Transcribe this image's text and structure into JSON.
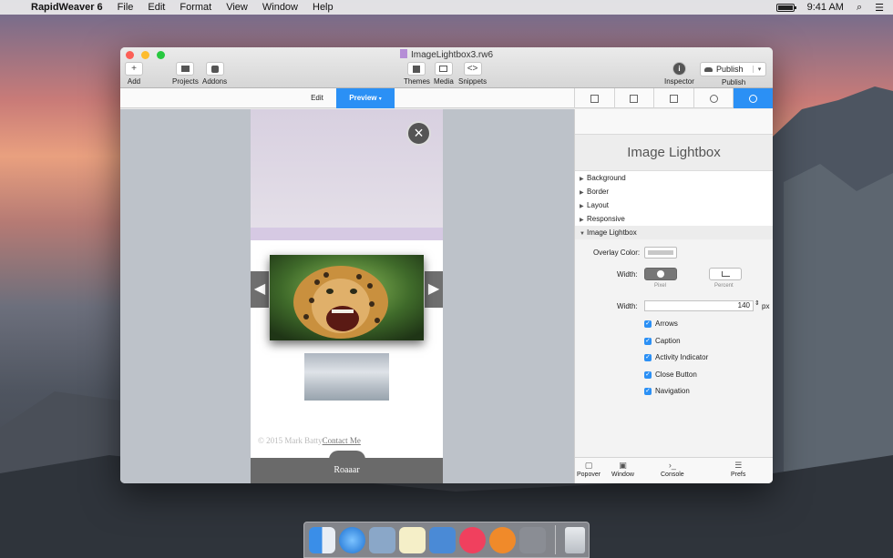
{
  "menubar": {
    "apple": "",
    "items": [
      "RapidWeaver 6",
      "File",
      "Edit",
      "Format",
      "View",
      "Window",
      "Help"
    ],
    "clock": "9:41 AM",
    "search_icon": "⌕",
    "list_icon": "☰"
  },
  "window": {
    "title": "ImageLightbox3.rw6",
    "toolbar": {
      "add": "Add",
      "add_glyph": "+",
      "projects": "Projects",
      "addons": "Addons",
      "themes": "Themes",
      "media": "Media",
      "snippets": "Snippets",
      "snippets_glyph": "<>",
      "inspector": "Inspector",
      "inspector_glyph": "i",
      "publish_button": "Publish",
      "publish_label": "Publish"
    },
    "tabs": {
      "edit": "Edit",
      "preview": "Preview"
    }
  },
  "preview": {
    "close_glyph": "×",
    "left_arrow": "◀",
    "right_arrow": "▶",
    "footer_text": "© 2015 Mark Batty",
    "footer_link": "Contact Me",
    "bottom_label": "Roaaar"
  },
  "inspector": {
    "title": "Image Lightbox",
    "sections": [
      "Background",
      "Border",
      "Layout",
      "Responsive",
      "Image Lightbox"
    ],
    "overlay_color_label": "Overlay Color:",
    "width_label": "Width:",
    "pixel_label": "Pixel",
    "percent_label": "Percent",
    "width_field_label": "Width:",
    "width_value": "140",
    "width_unit": "px",
    "checkboxes": [
      "Arrows",
      "Caption",
      "Activity Indicator",
      "Close Button",
      "Navigation"
    ],
    "bottom": [
      "Popover",
      "Window",
      "Console",
      "Prefs"
    ]
  },
  "colors": {
    "accent": "#2b90f5"
  }
}
